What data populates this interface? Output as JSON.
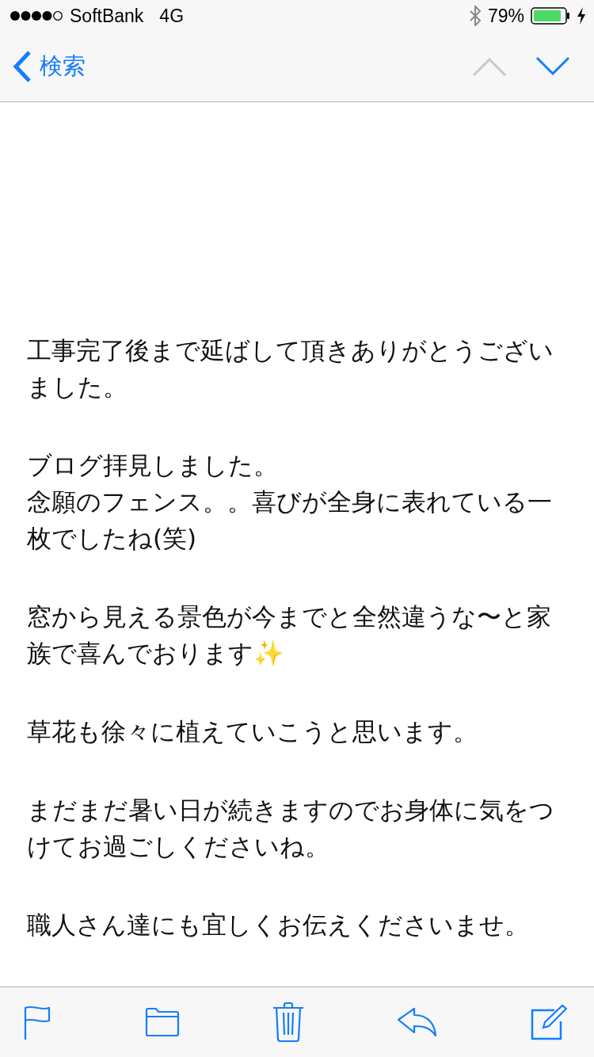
{
  "status_bar": {
    "carrier": "SoftBank",
    "network": "4G",
    "battery": "79%"
  },
  "nav": {
    "back": "検索",
    "arrows": [
      {
        "kind": "up",
        "disabled": true
      },
      {
        "kind": "down",
        "disabled": false
      }
    ]
  },
  "body": {
    "paragraphs": [
      [
        "工事完了後まで延ばして頂きありがとうございました。"
      ],
      [
        "ブログ拝見しました。",
        "念願のフェンス。。喜びが全身に表れている一枚でしたね(笑)"
      ],
      [
        "窓から見える景色が今までと全然違うな〜と家族で喜んでおります✨"
      ],
      [
        "草花も徐々に植えていこうと思います。"
      ],
      [
        "まだまだ暑い日が続きますのでお身体に気をつけてお過ごしくださいね。"
      ],
      [
        "職人さん達にも宜しくお伝えくださいませ。"
      ]
    ]
  },
  "toolbar": [
    {
      "kind": "flag"
    },
    {
      "kind": "folder"
    },
    {
      "kind": "trash"
    },
    {
      "kind": "reply"
    },
    {
      "kind": "compose"
    }
  ]
}
